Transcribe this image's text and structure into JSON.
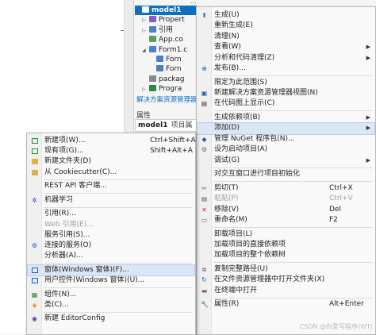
{
  "solution_explorer": {
    "top_clip": "...",
    "rows": [
      {
        "label": "model1",
        "selected": true,
        "arrow": "▲",
        "indent": 0
      },
      {
        "label": "Propert",
        "arrow": "▷",
        "indent": 1
      },
      {
        "label": "引用",
        "arrow": "▷",
        "indent": 1
      },
      {
        "label": "App.co",
        "arrow": "",
        "indent": 1
      },
      {
        "label": "Form1.c",
        "arrow": "◢",
        "indent": 1
      },
      {
        "label": "Forn",
        "arrow": "",
        "indent": 2
      },
      {
        "label": "Forn",
        "arrow": "",
        "indent": 2
      },
      {
        "label": "packag",
        "arrow": "",
        "indent": 1
      },
      {
        "label": "Progra",
        "arrow": "▷",
        "indent": 1
      }
    ],
    "footer_link": "解决方案资源管理器"
  },
  "properties": {
    "header": "属性",
    "object_name": "model1",
    "object_kind": "项目属性"
  },
  "context_menu": {
    "items": [
      {
        "type": "item",
        "icon": "build-icon",
        "glyph": "⬆",
        "icon_class": "i-blue",
        "label": "生成(U)"
      },
      {
        "type": "item",
        "label": "重新生成(E)"
      },
      {
        "type": "item",
        "label": "清理(N)"
      },
      {
        "type": "item",
        "label": "查看(W)",
        "submenu": true
      },
      {
        "type": "item",
        "label": "分析和代码清理(Z)",
        "submenu": true
      },
      {
        "type": "item",
        "icon": "publish-icon",
        "glyph": "⊕",
        "icon_class": "i-blue",
        "label": "发布(B)..."
      },
      {
        "type": "sep"
      },
      {
        "type": "item",
        "label": "限定为此范围(S)"
      },
      {
        "type": "item",
        "icon": "new-explorer-view-icon",
        "glyph": "▣",
        "icon_class": "i-blue",
        "label": "新建解决方案资源管理器视图(N)"
      },
      {
        "type": "item",
        "icon": "show-code-map-icon",
        "glyph": "▦",
        "icon_class": "i-gray",
        "label": "在代码图上显示(C)"
      },
      {
        "type": "sep"
      },
      {
        "type": "item",
        "label": "生成依赖项(B)",
        "submenu": true
      },
      {
        "type": "item",
        "label": "添加(D)",
        "submenu": true,
        "highlight": true
      },
      {
        "type": "item",
        "icon": "nuget-icon",
        "glyph": "◆",
        "icon_class": "i-blue",
        "label": "管理 NuGet 程序包(N)..."
      },
      {
        "type": "item",
        "icon": "startup-project-icon",
        "glyph": "⚙",
        "icon_class": "i-gray",
        "label": "设为启动项目(A)"
      },
      {
        "type": "item",
        "label": "调试(G)",
        "submenu": true
      },
      {
        "type": "sep"
      },
      {
        "type": "item",
        "label": "对交互窗口进行项目初始化"
      },
      {
        "type": "sep"
      },
      {
        "type": "item",
        "icon": "cut-icon",
        "glyph": "✂",
        "icon_class": "i-gray",
        "label": "剪切(T)",
        "shortcut": "Ctrl+X"
      },
      {
        "type": "item",
        "icon": "paste-icon",
        "glyph": "▤",
        "icon_class": "i-gray",
        "label": "粘贴(P)",
        "shortcut": "Ctrl+V",
        "disabled": true
      },
      {
        "type": "item",
        "icon": "remove-icon",
        "glyph": "✕",
        "icon_class": "i-red",
        "label": "移除(V)",
        "shortcut": "Del"
      },
      {
        "type": "item",
        "icon": "rename-icon",
        "glyph": "▭",
        "icon_class": "i-gray",
        "label": "重命名(M)",
        "shortcut": "F2"
      },
      {
        "type": "sep"
      },
      {
        "type": "item",
        "label": "卸载项目(L)"
      },
      {
        "type": "item",
        "label": "加载项目的直接依赖项"
      },
      {
        "type": "item",
        "label": "加载项目的整个依赖树"
      },
      {
        "type": "sep"
      },
      {
        "type": "item",
        "icon": "copy-path-icon",
        "glyph": "⧉",
        "icon_class": "i-gray",
        "label": "复制完整路径(U)"
      },
      {
        "type": "item",
        "icon": "open-folder-icon",
        "glyph": "↻",
        "icon_class": "i-blue",
        "label": "在文件资源管理器中打开文件夹(X)"
      },
      {
        "type": "item",
        "icon": "terminal-icon",
        "glyph": "▬",
        "icon_class": "i-gray",
        "label": "在终端中打开"
      },
      {
        "type": "sep"
      },
      {
        "type": "item",
        "icon": "properties-icon",
        "glyph": "🔧",
        "icon_class": "i-gray",
        "label": "属性(R)",
        "shortcut": "Alt+Enter"
      }
    ]
  },
  "add_submenu": {
    "items": [
      {
        "type": "item",
        "icon": "new-item-icon",
        "sq": "green",
        "label": "新建项(W)...",
        "shortcut": "Ctrl+Shift+A"
      },
      {
        "type": "item",
        "icon": "existing-item-icon",
        "sq": "green",
        "label": "现有项(G)...",
        "shortcut": "Shift+Alt+A"
      },
      {
        "type": "item",
        "icon": "new-folder-icon",
        "sq": "folder",
        "label": "新建文件夹(D)"
      },
      {
        "type": "item",
        "icon": "cookiecutter-icon",
        "sq": "folder",
        "label": "从 Cookiecutter(C)..."
      },
      {
        "type": "sep"
      },
      {
        "type": "item",
        "label": "REST API 客户端..."
      },
      {
        "type": "sep"
      },
      {
        "type": "item",
        "icon": "machine-learning-icon",
        "glyph": "✲",
        "icon_class": "i-purple",
        "label": "机器学习"
      },
      {
        "type": "sep"
      },
      {
        "type": "item",
        "label": "引用(R)..."
      },
      {
        "type": "item",
        "label": "Web 引用(E)...",
        "disabled": true
      },
      {
        "type": "item",
        "label": "服务引用(S)..."
      },
      {
        "type": "item",
        "icon": "connected-services-icon",
        "glyph": "⚙",
        "icon_class": "i-blue",
        "label": "连接的服务(O)"
      },
      {
        "type": "item",
        "label": "分析器(A)..."
      },
      {
        "type": "sep"
      },
      {
        "type": "item",
        "icon": "form-icon",
        "sq": "blue",
        "label": "窗体(Windows 窗体)(F)...",
        "highlight": true
      },
      {
        "type": "item",
        "icon": "user-control-icon",
        "sq": "blue",
        "label": "用户控件(Windows 窗体)(U)..."
      },
      {
        "type": "sep"
      },
      {
        "type": "item",
        "icon": "component-icon",
        "glyph": "▦",
        "icon_class": "i-green",
        "label": "组件(N)..."
      },
      {
        "type": "item",
        "icon": "class-icon",
        "glyph": "◈",
        "icon_class": "i-orange",
        "label": "类(C)..."
      },
      {
        "type": "sep"
      },
      {
        "type": "item",
        "icon": "editorconfig-icon",
        "glyph": "◉",
        "icon_class": "i-purple",
        "label": "新建 EditorConfig"
      }
    ]
  },
  "watermark": "CSDN @你爱写程序(WT)"
}
